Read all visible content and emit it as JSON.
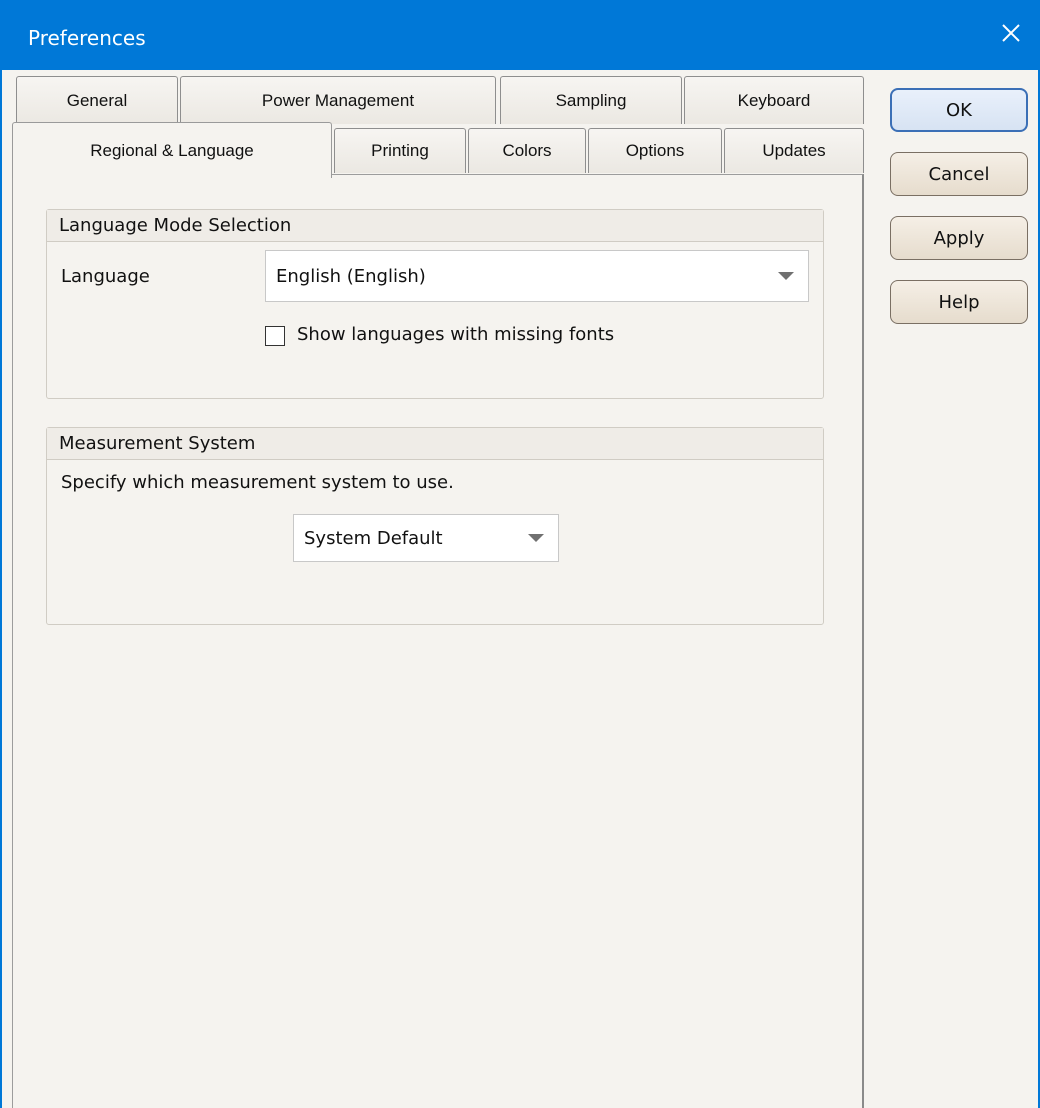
{
  "window": {
    "title": "Preferences"
  },
  "tabs": {
    "row1": [
      "General",
      "Power Management",
      "Sampling",
      "Keyboard"
    ],
    "row2": [
      "Regional & Language",
      "Printing",
      "Colors",
      "Options",
      "Updates"
    ],
    "active": "Regional & Language"
  },
  "language_group": {
    "title": "Language Mode Selection",
    "language_label": "Language",
    "language_value": "English (English)",
    "show_missing_fonts_label": "Show languages with missing fonts",
    "show_missing_fonts_checked": false
  },
  "measurement_group": {
    "title": "Measurement System",
    "description": "Specify which measurement system to use.",
    "system_value": "System Default"
  },
  "buttons": {
    "ok": "OK",
    "cancel": "Cancel",
    "apply": "Apply",
    "help": "Help"
  },
  "colors": {
    "titlebar": "#0078d7",
    "dialog_bg": "#f5f3ef"
  }
}
